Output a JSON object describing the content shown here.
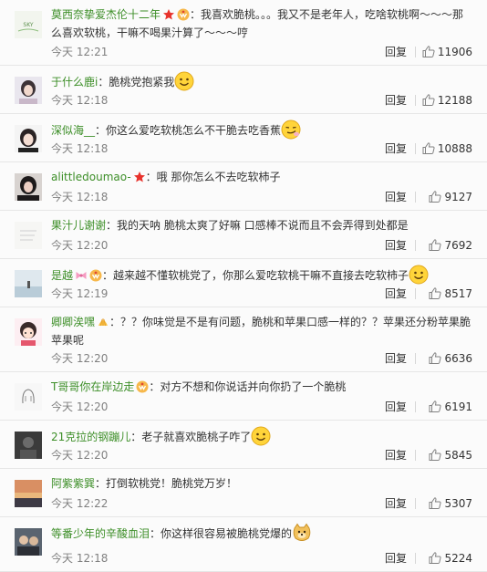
{
  "comments": [
    {
      "user": "莫西奈挚爱杰伦十二年",
      "badges": [
        "star-badge",
        "vip-badge"
      ],
      "sep": "：",
      "text": "我喜欢脆桃。。。我又不是老年人，吃啥软桃啊～～～那么喜欢软桃，干嘛不喝果汁算了～～～哼",
      "emoji": "",
      "time": "今天 12:21",
      "reply": "回复",
      "likes": "11906"
    },
    {
      "user": "于什么鹿i",
      "badges": [],
      "sep": "：",
      "text": "脆桃党抱紧我",
      "emoji": "smile-emoji",
      "time": "今天 12:18",
      "reply": "回复",
      "likes": "12188"
    },
    {
      "user": "深似海__",
      "badges": [],
      "sep": "：",
      "text": "你这么爱吃软桃怎么不干脆去吃香蕉",
      "emoji": "smirk-emoji",
      "time": "今天 12:18",
      "reply": "回复",
      "likes": "10888"
    },
    {
      "user": "alittledoumao-",
      "badges": [
        "star-badge"
      ],
      "sep": "：",
      "text": "哦 那你怎么不去吃软柿子",
      "emoji": "",
      "time": "今天 12:18",
      "reply": "回复",
      "likes": "9127"
    },
    {
      "user": "果汁儿谢谢",
      "badges": [],
      "sep": "：",
      "text": "我的天呐 脆桃太爽了好嘛 口感棒不说而且不会弄得到处都是",
      "emoji": "",
      "time": "今天 12:20",
      "reply": "回复",
      "likes": "7692"
    },
    {
      "user": "是越",
      "badges": [
        "bow-badge",
        "vip-badge"
      ],
      "sep": "：",
      "text": "越来越不懂软桃党了，你那么爱吃软桃干嘛不直接去吃软柿子",
      "emoji": "smile-emoji",
      "time": "今天 12:19",
      "reply": "回复",
      "likes": "8517"
    },
    {
      "user": "卿卿涘嘿",
      "badges": [
        "shell-badge"
      ],
      "sep": "：",
      "text": "？？你味觉是不是有问题，脆桃和苹果口感一样的？？苹果还分粉苹果脆苹果呢",
      "emoji": "",
      "time": "今天 12:20",
      "reply": "回复",
      "likes": "6636"
    },
    {
      "user": "T哥哥你在岸边走",
      "badges": [
        "vip-badge"
      ],
      "sep": "：",
      "text": "对方不想和你说话并向你扔了一个脆桃",
      "emoji": "",
      "time": "今天 12:20",
      "reply": "回复",
      "likes": "6191"
    },
    {
      "user": "21克拉的钢蹦儿",
      "badges": [],
      "sep": "：",
      "text": "老子就喜欢脆桃子咋了",
      "emoji": "smile-emoji",
      "time": "今天 12:20",
      "reply": "回复",
      "likes": "5845"
    },
    {
      "user": "阿紫紫巽",
      "badges": [],
      "sep": "：",
      "text": "打倒软桃党！脆桃党万岁！",
      "emoji": "",
      "time": "今天 12:22",
      "reply": "回复",
      "likes": "5307"
    },
    {
      "user": "等番少年的辛酸血泪",
      "badges": [],
      "sep": "：",
      "text": "你这样很容易被脆桃党爆的",
      "emoji": "doge-emoji",
      "time": "今天 12:18",
      "reply": "回复",
      "likes": "5224"
    }
  ],
  "colors": {
    "username": "#3c8e27",
    "meta": "#808080",
    "text": "#333333",
    "divider": "#e6e6e6"
  }
}
